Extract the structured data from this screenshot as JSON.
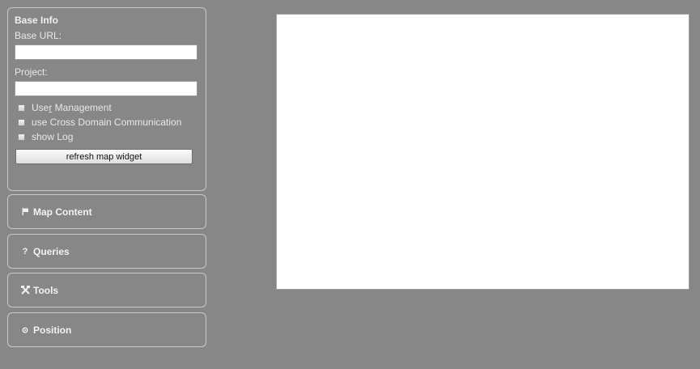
{
  "base_info": {
    "title": "Base Info",
    "base_url_label": "Base URL:",
    "base_url_value": "",
    "project_label": "Project:",
    "project_value": "",
    "options": [
      {
        "label_before": "Use",
        "label_underlined": "r",
        "label_after": " Management",
        "checked": false
      },
      {
        "label": "use Cross Domain Communication",
        "checked": false
      },
      {
        "label": "show Log",
        "checked": false
      }
    ],
    "refresh_button": "refresh map widget"
  },
  "accordion": [
    {
      "label": "Map Content",
      "icon": "flag-icon"
    },
    {
      "label": "Queries",
      "icon": "question-icon"
    },
    {
      "label": "Tools",
      "icon": "tools-icon"
    },
    {
      "label": "Position",
      "icon": "position-icon"
    }
  ],
  "colors": {
    "background": "#878787",
    "panel_border": "#c8c8c8",
    "map_background": "#ffffff"
  }
}
